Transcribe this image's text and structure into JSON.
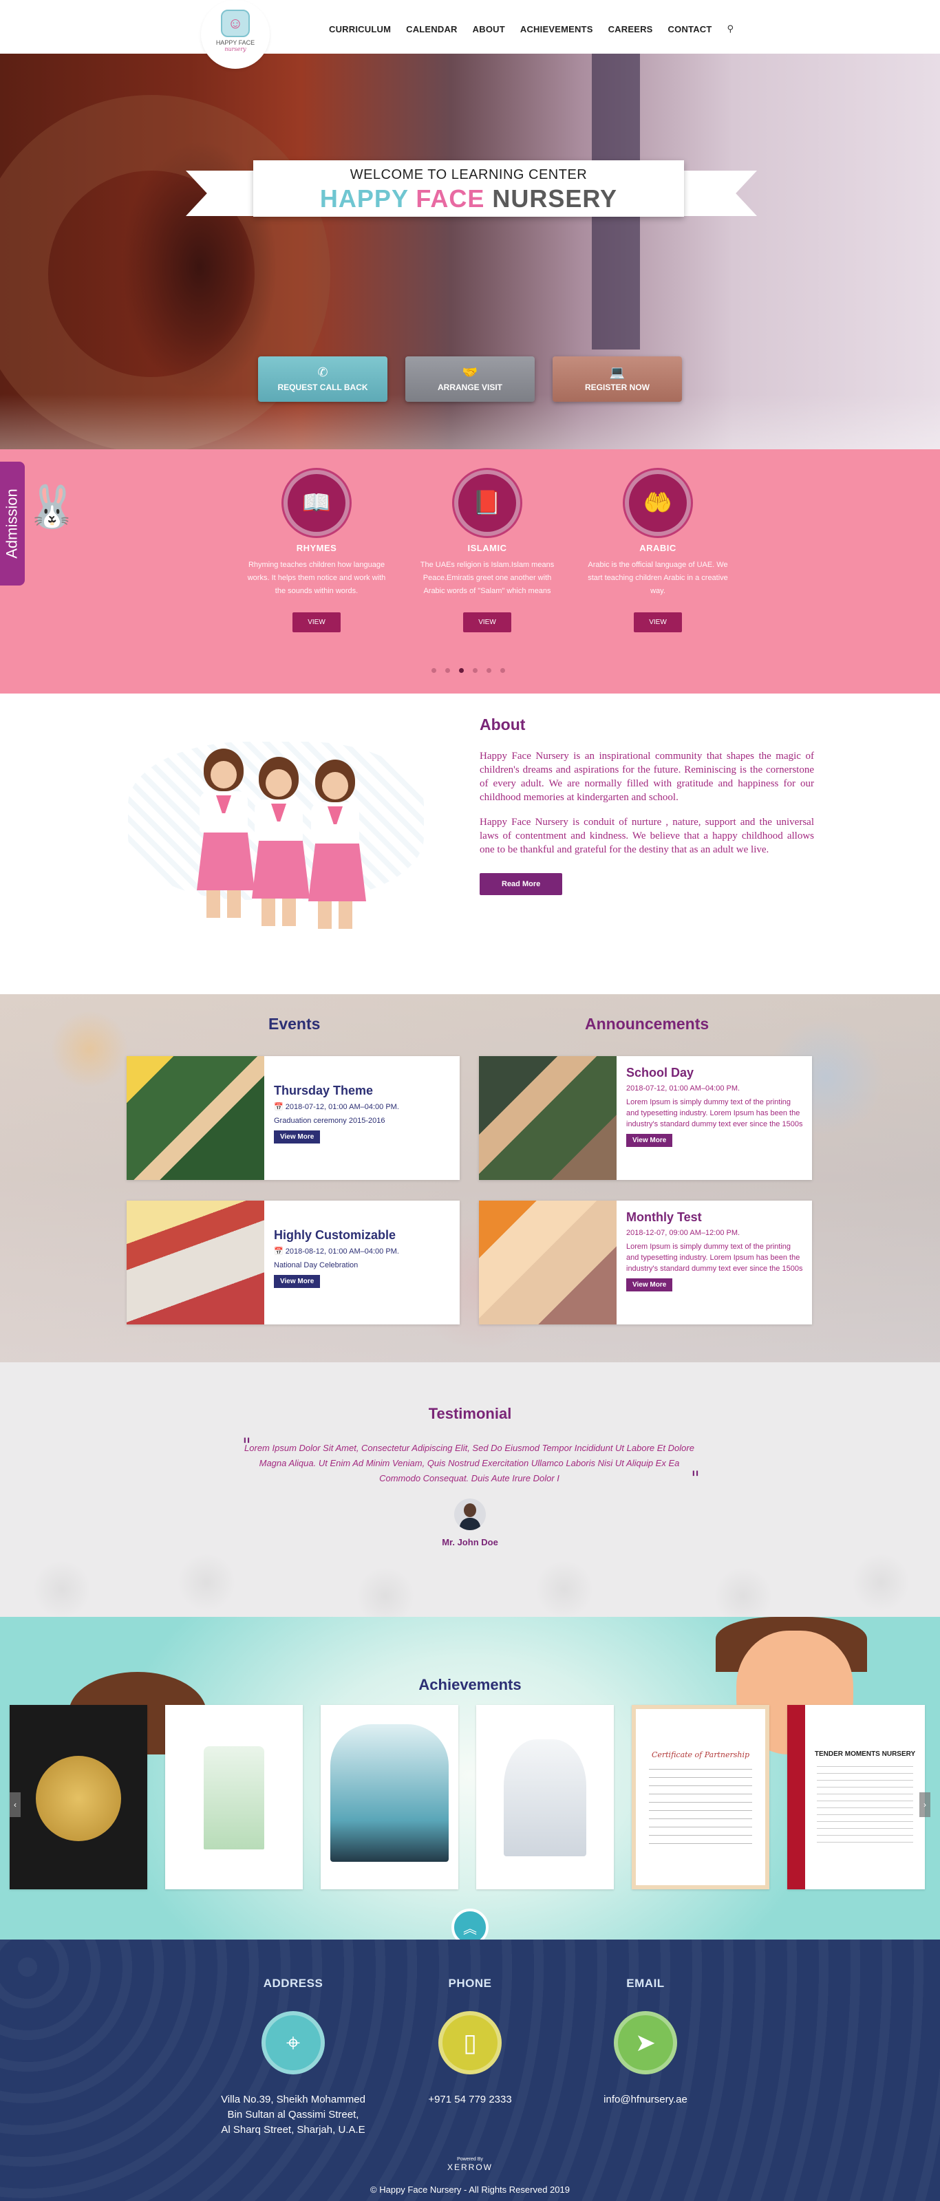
{
  "logo": {
    "name": "HAPPY FACE",
    "sub": "nursery"
  },
  "nav": {
    "items": [
      "CURRICULUM",
      "CALENDAR",
      "ABOUT",
      "ACHIEVEMENTS",
      "CAREERS",
      "CONTACT"
    ],
    "search_glyph": "⚲"
  },
  "hero": {
    "welcome": "WELCOME TO LEARNING CENTER",
    "brand_w1": "HAPPY",
    "brand_w2": "FACE",
    "brand_w3": "NURSERY",
    "buttons": [
      {
        "label": "REQUEST CALL BACK",
        "icon": "phone-icon",
        "glyph": "✆"
      },
      {
        "label": "ARRANGE VISIT",
        "icon": "handshake-icon",
        "glyph": "🤝"
      },
      {
        "label": "REGISTER NOW",
        "icon": "laptop-icon",
        "glyph": "💻"
      }
    ]
  },
  "programs": {
    "admission": "Admission",
    "items": [
      {
        "title": "RHYMES",
        "desc": "Rhyming teaches children how language works. It helps them notice and work with the sounds within words.",
        "button": "VIEW",
        "icon": "book-reader-icon",
        "glyph": "📖"
      },
      {
        "title": "ISLAMIC",
        "desc": "The UAEs religion is Islam.Islam means Peace.Emiratis greet one another with Arabic words of \"Salam\" which means Peace.",
        "button": "VIEW",
        "icon": "quran-icon",
        "glyph": "📕"
      },
      {
        "title": "ARABIC",
        "desc": "Arabic is the official language of UAE. We start teaching children Arabic in a creative way.",
        "button": "VIEW",
        "icon": "hand-letter-icon",
        "glyph": "🤲"
      }
    ],
    "slider_dots": 6,
    "active_dot": 2
  },
  "about": {
    "title": "About",
    "p1": "Happy Face Nursery is an inspirational community that shapes the magic of children's dreams and aspirations for the future. Reminiscing is the cornerstone of every adult. We are normally filled with gratitude and happiness for our childhood memories at kindergarten and school.",
    "p2": "Happy Face Nursery is conduit of nurture , nature, support and the universal laws of contentment and kindness. We believe that a happy childhood allows one to be thankful and grateful for the destiny that as an adult we live.",
    "button": "Read More"
  },
  "events": {
    "title": "Events",
    "items": [
      {
        "title": "Thursday Theme",
        "date": "2018-07-12, 01:00 AM–04:00 PM.",
        "desc": "Graduation ceremony 2015-2016",
        "button": "View More"
      },
      {
        "title": "Highly Customizable",
        "date": "2018-08-12, 01:00 AM–04:00 PM.",
        "desc": "National Day Celebration",
        "button": "View More"
      }
    ]
  },
  "announcements": {
    "title": "Announcements",
    "items": [
      {
        "title": "School Day",
        "date": "2018-07-12, 01:00 AM–04:00 PM.",
        "desc": "Lorem Ipsum is simply dummy text of the printing and typesetting industry. Lorem Ipsum has been the industry's standard dummy text ever since the 1500s",
        "button": "View More"
      },
      {
        "title": "Monthly Test",
        "date": "2018-12-07, 09:00 AM–12:00 PM.",
        "desc": "Lorem Ipsum is simply dummy text of the printing and typesetting industry. Lorem Ipsum has been the industry's standard dummy text ever since the 1500s",
        "button": "View More"
      }
    ]
  },
  "testimonial": {
    "title": "Testimonial",
    "quote": "Lorem Ipsum Dolor Sit Amet, Consectetur Adipiscing Elit, Sed Do Eiusmod Tempor Incididunt Ut Labore Et Dolore Magna Aliqua. Ut Enim Ad Minim Veniam, Quis Nostrud Exercitation Ullamco Laboris Nisi Ut Aliquip Ex Ea Commodo Consequat. Duis Aute Irure Dolor I",
    "name": "Mr. John Doe"
  },
  "achievements": {
    "title": "Achievements",
    "cert_partnership": "Certificate of Partnership",
    "cert_nursery": "TENDER MOMENTS NURSERY"
  },
  "contact": {
    "address_label": "ADDRESS",
    "address_lines": [
      "Villa No.39, Sheikh Mohammed",
      "Bin Sultan al Qassimi Street,",
      "Al Sharq Street, Sharjah, U.A.E"
    ],
    "phone_label": "PHONE",
    "phone": "+971 54 779 2333",
    "email_label": "EMAIL",
    "email": "info@hfnursery.ae",
    "powered_by": "Powered By",
    "powered_brand": "XERROW",
    "copyright": "© Happy Face Nursery - All Rights Reserved 2019"
  },
  "colors": {
    "purple": "#7a2577",
    "navy": "#2c2f74",
    "pink": "#f58fa5",
    "footer": "#273a6a"
  }
}
